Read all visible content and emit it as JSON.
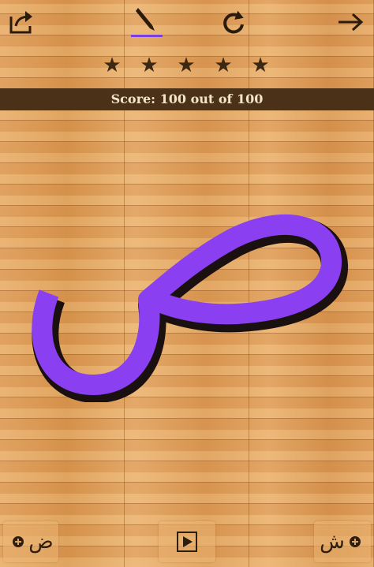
{
  "toolbar": {
    "share_icon": "share-icon",
    "pen_icon": "pen-icon",
    "reload_icon": "reload-icon",
    "next_icon": "arrow-right-icon",
    "pen_underline_color": "#7b3fe0"
  },
  "rating": {
    "stars": 5,
    "max": 5
  },
  "score": {
    "text": "Score: 100 out of 100",
    "value": 100,
    "max": 100
  },
  "letter": {
    "character": "ص",
    "fill_color": "#8a3ff0",
    "outline_color": "#1a1010"
  },
  "bottom": {
    "prev_label": "ض",
    "next_label": "ش",
    "play_icon": "play-icon",
    "prev_icon": "circle-plus-icon",
    "next_icon": "circle-plus-icon"
  }
}
